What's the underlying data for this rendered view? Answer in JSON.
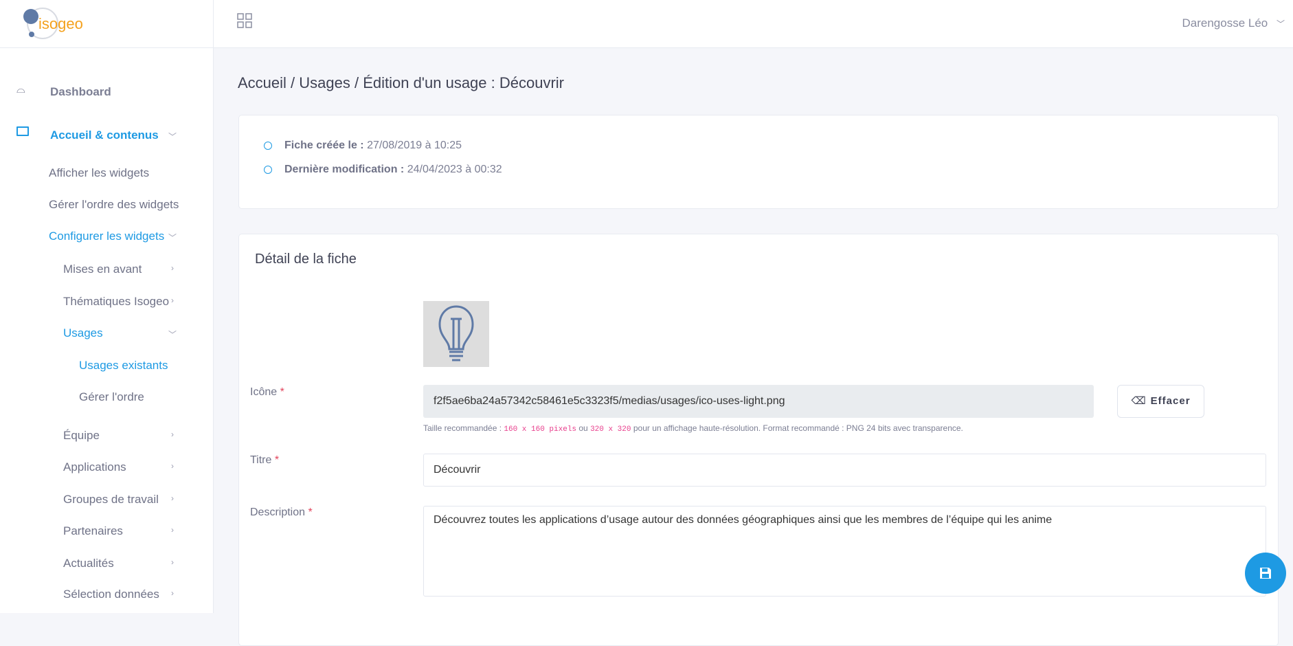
{
  "brand": {
    "logo_text": "isogeo"
  },
  "header": {
    "user_name": "Darengosse Léo"
  },
  "sidebar": {
    "dashboard": "Dashboard",
    "accueil": "Accueil & contenus",
    "items": [
      {
        "label": "Afficher les widgets"
      },
      {
        "label": "Gérer l'ordre des widgets"
      },
      {
        "label": "Configurer les widgets"
      },
      {
        "label": "Mises en avant"
      },
      {
        "label": "Thématiques Isogeo"
      },
      {
        "label": "Usages"
      },
      {
        "label": "Usages existants"
      },
      {
        "label": "Gérer l'ordre"
      },
      {
        "label": "Équipe"
      },
      {
        "label": "Applications"
      },
      {
        "label": "Groupes de travail"
      },
      {
        "label": "Partenaires"
      },
      {
        "label": "Actualités"
      },
      {
        "label": "Sélection données"
      }
    ]
  },
  "breadcrumb": "Accueil / Usages / Édition d'un usage : Découvrir",
  "meta": {
    "created_label": "Fiche créée le :",
    "created_value": "27/08/2019 à 10:25",
    "modified_label": "Dernière modification :",
    "modified_value": "24/04/2023 à 00:32"
  },
  "detail": {
    "title": "Détail de la fiche",
    "icon_label": "Icône",
    "icon_value": "f2f5ae6ba24a57342c58461e5c3323f5/medias/usages/ico-uses-light.png",
    "clear_button": "Effacer",
    "help_prefix": "Taille recommandée :",
    "help_size1": "160 x 160 pixels",
    "help_or": "ou",
    "help_size2": "320 x 320",
    "help_suffix": "pour un affichage haute-résolution. Format recommandé : PNG 24 bits avec transparence.",
    "title_label": "Titre",
    "title_value": "Découvrir",
    "desc_label": "Description",
    "desc_value": "Découvrez toutes les applications d’usage autour des données géographiques ainsi que les membres de l’équipe qui les anime",
    "required_mark": "*"
  },
  "colors": {
    "accent": "#1e9ae3",
    "logo_orange": "#f4a11d",
    "logo_blue": "#5f7aa6"
  }
}
